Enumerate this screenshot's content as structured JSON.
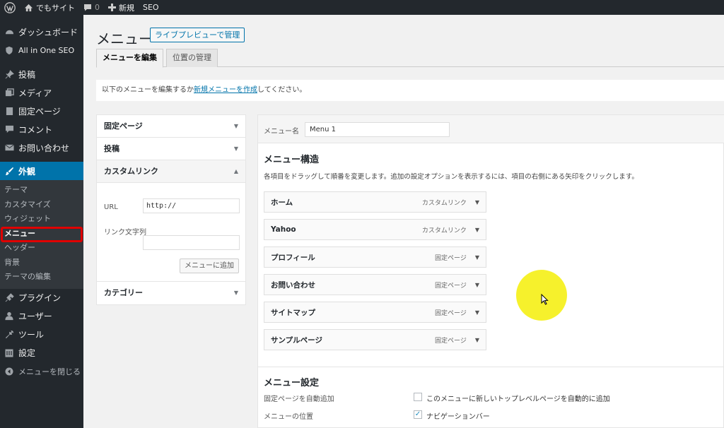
{
  "adminbar": {
    "site_name": "でもサイト",
    "comments_count": "0",
    "new_label": "新規",
    "seo_label": "SEO"
  },
  "sidebar": {
    "items": [
      {
        "label": "ダッシュボード",
        "icon": "dashboard-icon"
      },
      {
        "label": "All in One SEO",
        "icon": "seo-shield-icon"
      },
      {
        "label": "投稿",
        "icon": "pin-icon"
      },
      {
        "label": "メディア",
        "icon": "media-icon"
      },
      {
        "label": "固定ページ",
        "icon": "page-icon"
      },
      {
        "label": "コメント",
        "icon": "comment-icon"
      },
      {
        "label": "お問い合わせ",
        "icon": "mail-icon"
      },
      {
        "label": "外観",
        "icon": "brush-icon"
      }
    ],
    "submenu": [
      "テーマ",
      "カスタマイズ",
      "ウィジェット",
      "メニュー",
      "ヘッダー",
      "背景",
      "テーマの編集"
    ],
    "items_after": [
      {
        "label": "プラグイン",
        "icon": "plugin-icon"
      },
      {
        "label": "ユーザー",
        "icon": "user-icon"
      },
      {
        "label": "ツール",
        "icon": "wrench-icon"
      },
      {
        "label": "設定",
        "icon": "settings-icon"
      },
      {
        "label": "メニューを閉じる",
        "icon": "collapse-icon"
      }
    ]
  },
  "page": {
    "title": "メニュー",
    "live_preview": "ライブプレビューで管理",
    "tabs": [
      "メニューを編集",
      "位置の管理"
    ],
    "notice_pre": "以下のメニューを編集するか",
    "notice_link": "新規メニューを作成",
    "notice_post": "してください。"
  },
  "accordion": {
    "fixed_pages": "固定ページ",
    "posts": "投稿",
    "custom_link": "カスタムリンク",
    "url_label": "URL",
    "url_value": "http://",
    "link_text_label": "リンク文字列",
    "link_text_value": "",
    "add_button": "メニューに追加",
    "categories": "カテゴリー"
  },
  "menu": {
    "name_label": "メニュー名",
    "name_value": "Menu 1",
    "structure_title": "メニュー構造",
    "structure_desc": "各項目をドラッグして順番を変更します。追加の設定オプションを表示するには、項目の右側にある矢印をクリックします。",
    "items": [
      {
        "title": "ホーム",
        "type": "カスタムリンク"
      },
      {
        "title": "Yahoo",
        "type": "カスタムリンク"
      },
      {
        "title": "プロフィール",
        "type": "固定ページ"
      },
      {
        "title": "お問い合わせ",
        "type": "固定ページ"
      },
      {
        "title": "サイトマップ",
        "type": "固定ページ"
      },
      {
        "title": "サンプルページ",
        "type": "固定ページ"
      }
    ],
    "settings_title": "メニュー設定",
    "auto_add_label": "固定ページを自動追加",
    "auto_add_option": "このメニューに新しいトップレベルページを自動的に追加",
    "auto_add_checked": false,
    "location_label": "メニューの位置",
    "location_option": "ナビゲーションバー",
    "location_checked": true
  },
  "colors": {
    "accent": "#0073aa",
    "highlight_box": "#e00000",
    "cursor_halo": "#f5f01a"
  }
}
